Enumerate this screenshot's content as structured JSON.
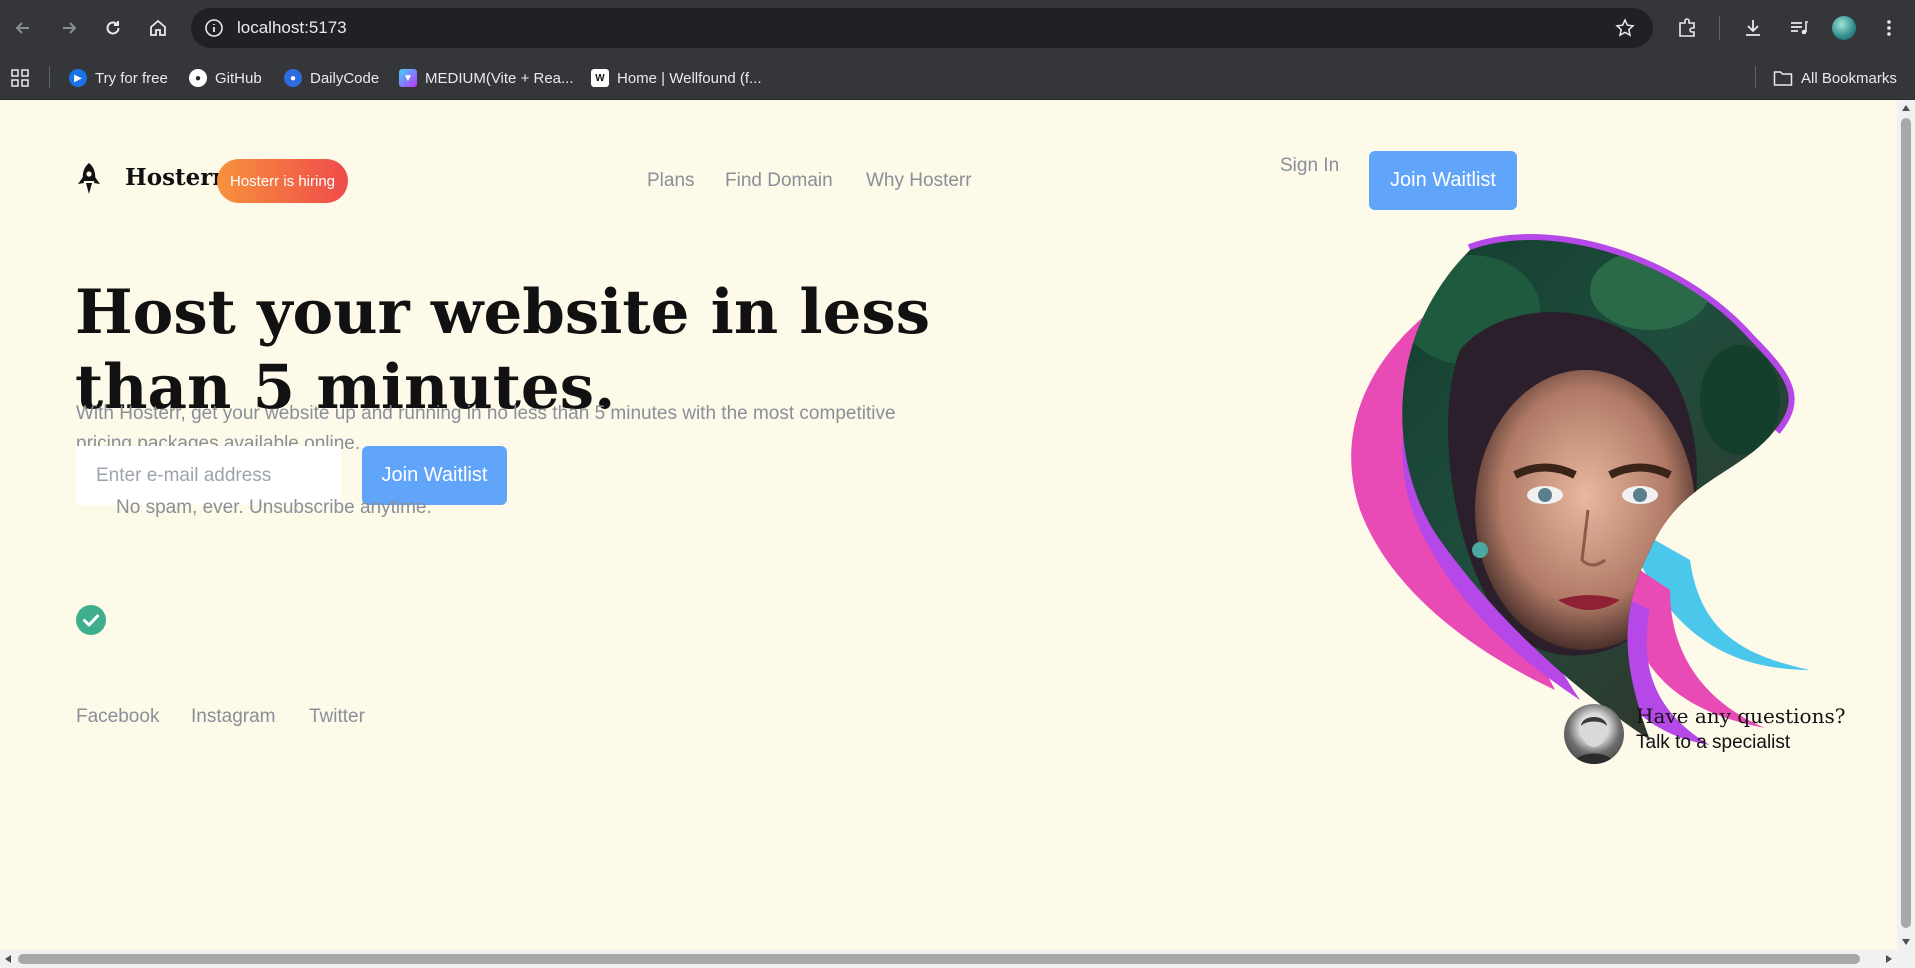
{
  "browser": {
    "url": "localhost:5173",
    "bookmarks": [
      {
        "label": "Try for free",
        "icon": "play-icon",
        "color": "#1a73e8"
      },
      {
        "label": "GitHub",
        "icon": "github-icon",
        "color": "#ffffff"
      },
      {
        "label": "DailyCode",
        "icon": "avatar-icon",
        "color": "#2d6cdf"
      },
      {
        "label": "MEDIUM(Vite + Rea...",
        "icon": "vite-icon",
        "color": "#a855f7"
      },
      {
        "label": "Home | Wellfound (f...",
        "icon": "wellfound-icon",
        "color": "#ffffff"
      }
    ],
    "all_bookmarks_label": "All Bookmarks"
  },
  "header": {
    "brand": "Hosterr",
    "hiring_badge": "Hosterr is hiring",
    "nav": [
      "Plans",
      "Find Domain",
      "Why Hosterr"
    ],
    "sign_in": "Sign In",
    "cta": "Join Waitlist"
  },
  "hero": {
    "title": "Host your website in less than 5 minutes.",
    "subtitle": "With Hosterr, get your website up and running in no less than 5 minutes with the most competitive pricing packages available online.",
    "email_placeholder": "Enter e-mail address",
    "cta": "Join Waitlist",
    "note": "No spam, ever. Unsubscribe anytime."
  },
  "footer": {
    "social": [
      "Facebook",
      "Instagram",
      "Twitter"
    ],
    "question": "Have any questions?",
    "contact": "Talk to a specialist"
  },
  "colors": {
    "page_bg": "#fdfaea",
    "accent": "#60a5fa",
    "hiring_from": "#f7923c",
    "hiring_to": "#ef4b4b",
    "check": "#3fae8c",
    "muted_text": "#8a8f98"
  }
}
